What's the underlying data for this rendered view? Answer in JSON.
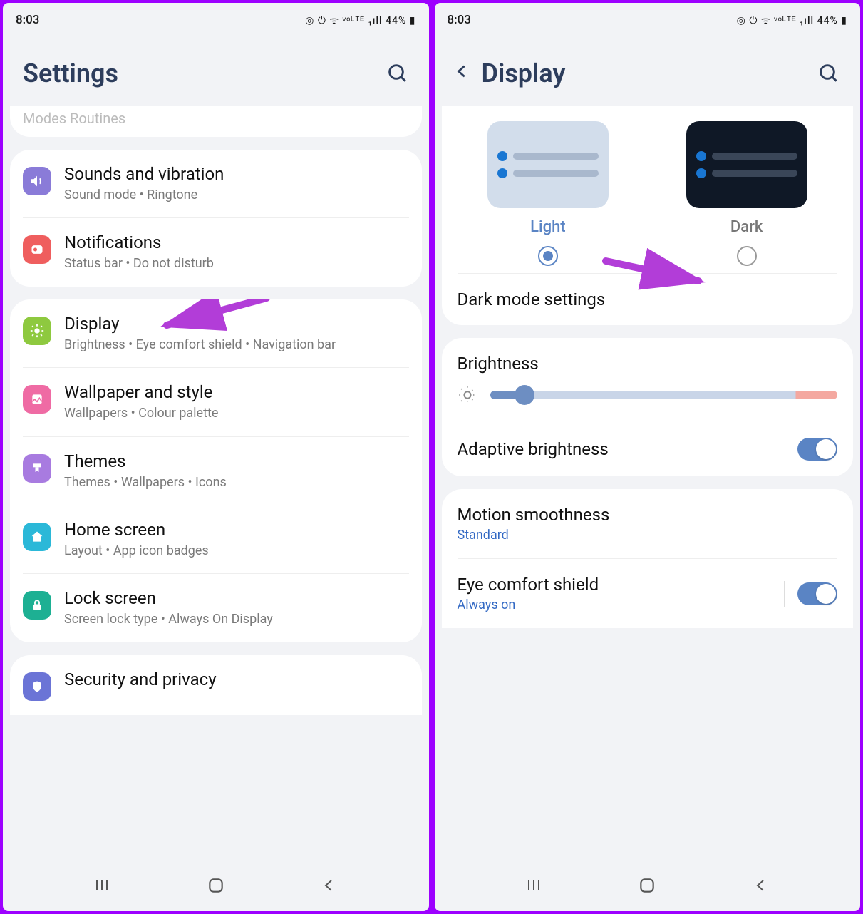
{
  "status": {
    "time": "8:03",
    "battery": "44%"
  },
  "left": {
    "title": "Settings",
    "fadedTop": "Modes   Routines",
    "items": [
      {
        "icon": "sound",
        "color": "#8a7bd8",
        "title": "Sounds and vibration",
        "sub": "Sound mode  •  Ringtone"
      },
      {
        "icon": "notif",
        "color": "#ef5e5e",
        "title": "Notifications",
        "sub": "Status bar  •  Do not disturb"
      }
    ],
    "items2": [
      {
        "icon": "display",
        "color": "#8ec93f",
        "title": "Display",
        "sub": "Brightness  •  Eye comfort shield  •  Navigation bar"
      },
      {
        "icon": "wallpaper",
        "color": "#ef6ba4",
        "title": "Wallpaper and style",
        "sub": "Wallpapers  •  Colour palette"
      },
      {
        "icon": "themes",
        "color": "#a87be0",
        "title": "Themes",
        "sub": "Themes  •  Wallpapers  •  Icons"
      },
      {
        "icon": "home",
        "color": "#2bb8d8",
        "title": "Home screen",
        "sub": "Layout  •  App icon badges"
      },
      {
        "icon": "lock",
        "color": "#1db093",
        "title": "Lock screen",
        "sub": "Screen lock type  •  Always On Display"
      }
    ],
    "items3": [
      {
        "icon": "security",
        "color": "#6b74d6",
        "title": "Security and privacy",
        "sub": ""
      }
    ]
  },
  "right": {
    "title": "Display",
    "lightLabel": "Light",
    "darkLabel": "Dark",
    "darkModeSettings": "Dark mode settings",
    "brightness": "Brightness",
    "adaptive": "Adaptive brightness",
    "motion": "Motion smoothness",
    "motionSub": "Standard",
    "eye": "Eye comfort shield",
    "eyeSub": "Always on"
  }
}
